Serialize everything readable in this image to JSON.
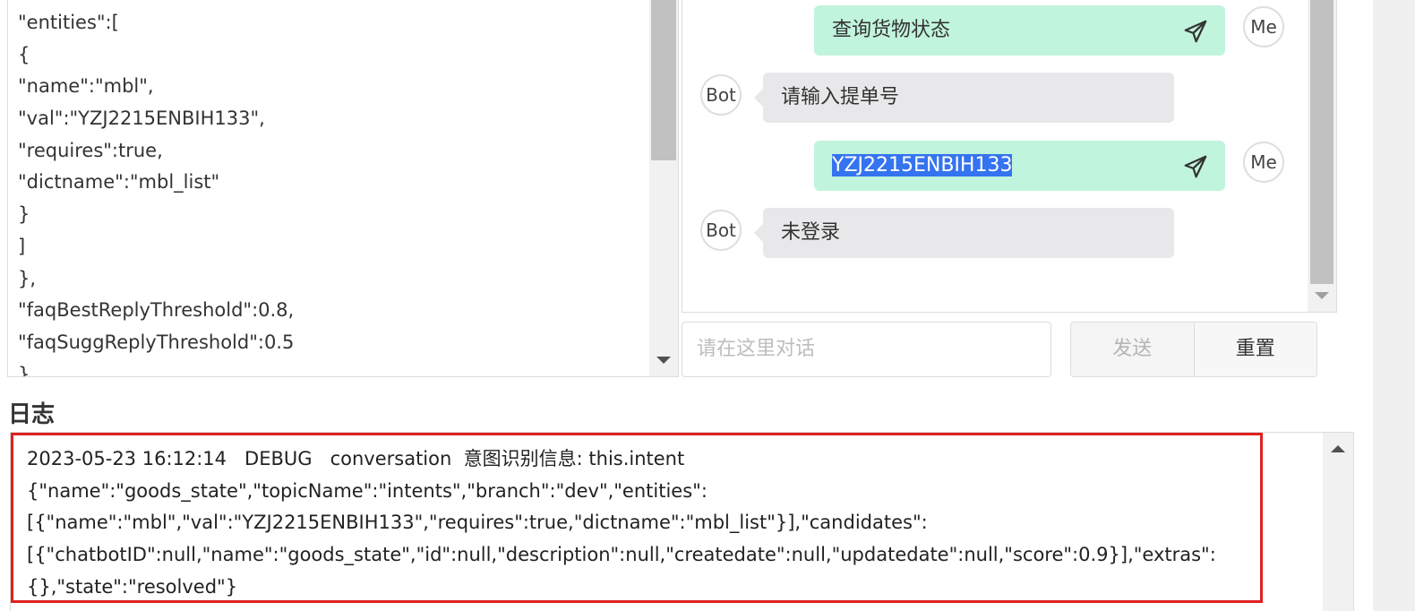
{
  "json_editor": {
    "lines": [
      "\"entities\":[",
      "{",
      "\"name\":\"mbl\",",
      "\"val\":\"YZJ2215ENBIH133\",",
      "\"requires\":true,",
      "\"dictname\":\"mbl_list\"",
      "}",
      "]",
      "},",
      "\"faqBestReplyThreshold\":0.8,",
      "\"faqSuggReplyThreshold\":0.5",
      "}"
    ]
  },
  "chat": {
    "messages": [
      {
        "sender": "Me",
        "text": "查询货物状态"
      },
      {
        "sender": "Bot",
        "text": "请输入提单号"
      },
      {
        "sender": "Me",
        "text": "YZJ2215ENBIH133"
      },
      {
        "sender": "Bot",
        "text": "未登录"
      }
    ],
    "input_placeholder": "请在这里对话",
    "send_label": "发送",
    "reset_label": "重置",
    "icons": {
      "send": "paper-plane-icon"
    }
  },
  "log": {
    "title": "日志",
    "lines": [
      "2023-05-23 16:12:14   DEBUG   conversation  意图识别信息: this.intent",
      "{\"name\":\"goods_state\",\"topicName\":\"intents\",\"branch\":\"dev\",\"entities\":",
      "[{\"name\":\"mbl\",\"val\":\"YZJ2215ENBIH133\",\"requires\":true,\"dictname\":\"mbl_list\"}],\"candidates\":",
      "[{\"chatbotID\":null,\"name\":\"goods_state\",\"id\":null,\"description\":null,\"createdate\":null,\"updatedate\":null,\"score\":0.9}],\"extras\":",
      "{},\"state\":\"resolved\"}"
    ]
  },
  "colors": {
    "me_bubble": "#c1f4dc",
    "bot_bubble": "#e8e8ea",
    "highlight_border": "#e02020",
    "selection": "#3574f0"
  }
}
